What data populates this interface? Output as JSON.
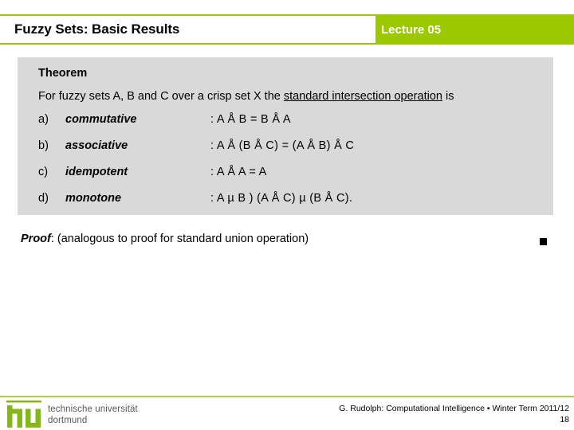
{
  "header": {
    "title": "Fuzzy Sets: Basic Results",
    "lecture": "Lecture 05",
    "accent_color": "#9CC800",
    "title_bg": "#ffffff"
  },
  "theorem": {
    "heading": "Theorem",
    "statement_prefix": "For fuzzy sets A, B and C over a crisp set X the ",
    "statement_emphasis": "standard intersection operation",
    "statement_suffix": " is",
    "box_color": "#d9d9d9",
    "properties": [
      {
        "marker": "a)",
        "name": "commutative",
        "formula": ": A Å B = B Å A"
      },
      {
        "marker": "b)",
        "name": "associative",
        "formula": ": A Å (B Å C) = (A Å B) Å C"
      },
      {
        "marker": "c)",
        "name": "idempotent",
        "formula": ": A Å A = A"
      },
      {
        "marker": "d)",
        "name": "monotone",
        "formula": ": A µ B  )  (A Å C) µ (B Å C)."
      }
    ]
  },
  "proof": {
    "label": "Proof",
    "text": ": (analogous to proof for standard union operation)",
    "qed_symbol": "■"
  },
  "footer": {
    "logo_line1": "technische universität",
    "logo_line2": "dortmund",
    "credit": "G. Rudolph: Computational Intelligence ▪ Winter Term 2011/12",
    "page_number": "18",
    "rule_color": "#b5cf3c",
    "logo_color": "#83b818"
  }
}
